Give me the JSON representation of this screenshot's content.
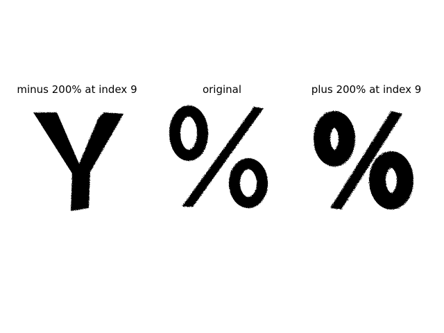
{
  "panels": [
    {
      "title": "minus 200% at index 9",
      "glyph": "letter-y-glyph"
    },
    {
      "title": "original",
      "glyph": "percent-sign-glyph"
    },
    {
      "title": "plus 200% at index 9",
      "glyph": "percent-sign-bold-glyph"
    }
  ],
  "colors": {
    "background": "#ffffff",
    "ink": "#000000"
  }
}
